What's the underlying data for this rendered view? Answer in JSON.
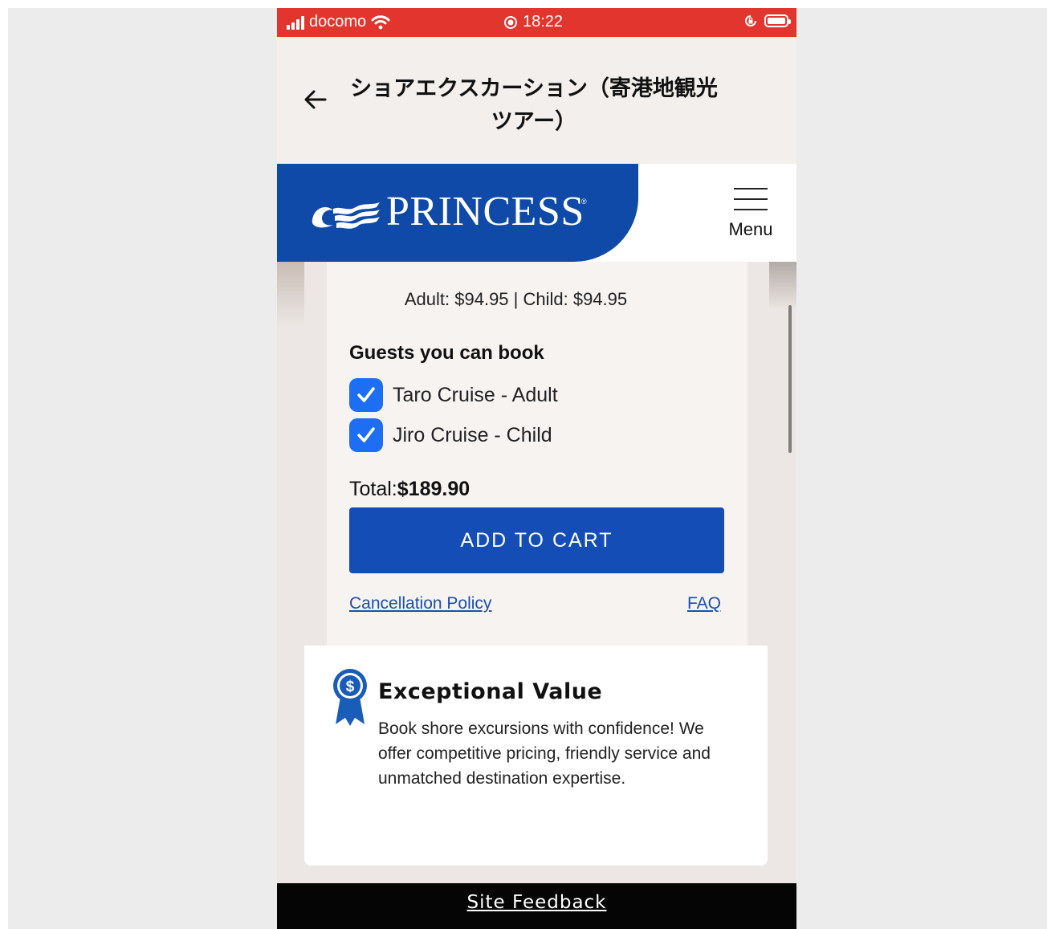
{
  "status_bar": {
    "carrier": "docomo",
    "time": "18:22"
  },
  "header": {
    "title": "ショアエクスカーション（寄港地観光ツアー）"
  },
  "nav": {
    "brand": "PRINCESS",
    "brand_mark": "®",
    "menu_label": "Menu",
    "brand_color": "#0f4aa8"
  },
  "booking": {
    "price_line": "Adult: $94.95 | Child: $94.95",
    "guests_heading": "Guests you can book",
    "guests": [
      {
        "name": "Taro Cruise - Adult",
        "checked": true
      },
      {
        "name": "Jiro Cruise - Child",
        "checked": true
      }
    ],
    "total_label": "Total:",
    "total_value": "$189.90",
    "add_to_cart_label": "ADD TO CART",
    "cancellation_link": "Cancellation Policy",
    "faq_link": "FAQ"
  },
  "value": {
    "title": "Exceptional Value",
    "body": "Book shore excursions with confidence! We offer competitive pricing, friendly service and unmatched destination expertise."
  },
  "footer": {
    "feedback_label": "Site Feedback"
  }
}
